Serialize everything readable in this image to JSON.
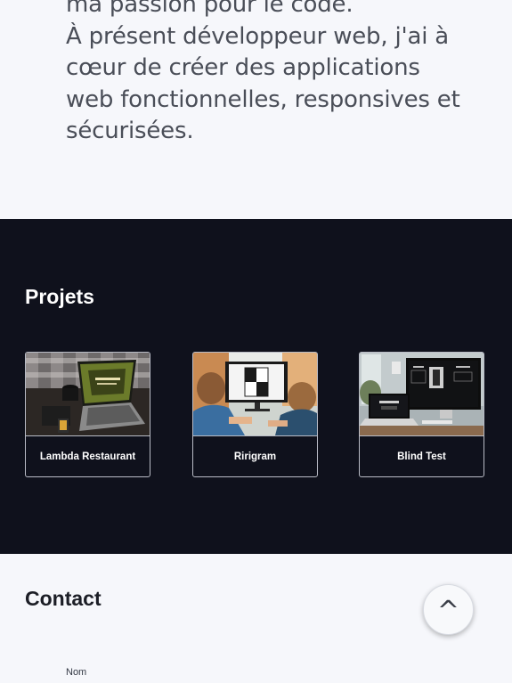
{
  "about": {
    "lines": [
      "ma passion pour le code.",
      "À présent développeur web, j'ai à",
      "cœur de créer des applications",
      "web fonctionnelles, responsives et",
      "sécurisées."
    ]
  },
  "projects": {
    "title": "Projets",
    "items": [
      {
        "label": "Lambda Restaurant"
      },
      {
        "label": "Ririgram"
      },
      {
        "label": "Blind Test"
      }
    ]
  },
  "contact": {
    "title": "Contact",
    "name_label": "Nom"
  },
  "scroll_top": {
    "icon": "chevron-up-icon",
    "glyph": "^"
  },
  "colors": {
    "dark_section": "#0f111c",
    "light_section": "#f6f7fb",
    "text_muted": "#4a4e58"
  }
}
